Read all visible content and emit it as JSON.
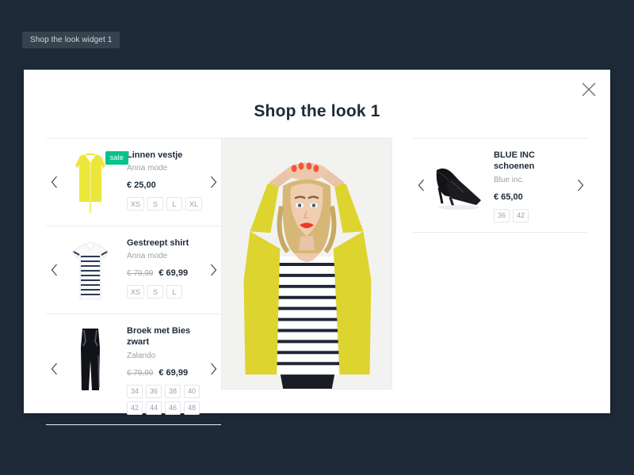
{
  "backdrop": {
    "color": "#1e2a38",
    "widget_tab_label": "Shop the look widget 1"
  },
  "modal": {
    "title": "Shop the look 1",
    "close_icon": "close-icon",
    "prev_icon": "chevron-left-icon",
    "next_icon": "chevron-right-icon"
  },
  "hero": {
    "alt": "Model wearing yellow cardigan over striped shirt, arms raised"
  },
  "colors": {
    "sale_badge": "#06c38c",
    "text_dark": "#1e2a38",
    "text_muted": "#9aa1aa",
    "divider": "#ededed",
    "cardigan_yellow": "#e8df35"
  },
  "left_products": [
    {
      "name": "Linnen vestje",
      "brand": "Anna mode",
      "old_price": "",
      "price": "€ 25,00",
      "badge": "sale",
      "sizes": [
        "XS",
        "S",
        "L",
        "XL"
      ],
      "thumb": "yellow-cardigan"
    },
    {
      "name": "Gestreept shirt",
      "brand": "Anna mode",
      "old_price": "€ 79,99",
      "price": "€ 69,99",
      "badge": "",
      "sizes": [
        "XS",
        "S",
        "L"
      ],
      "thumb": "striped-shirt"
    },
    {
      "name": "Broek met Bies zwart",
      "brand": "Zalando",
      "old_price": "€ 79,99",
      "price": "€ 69,99",
      "badge": "",
      "sizes": [
        "34",
        "36",
        "38",
        "40",
        "42",
        "44",
        "46",
        "48"
      ],
      "thumb": "black-trousers"
    }
  ],
  "right_products": [
    {
      "name": "BLUE INC schoenen",
      "brand": "Blue inc.",
      "old_price": "",
      "price": "€ 65,00",
      "badge": "",
      "sizes": [
        "36",
        "42"
      ],
      "thumb": "black-heels"
    }
  ]
}
